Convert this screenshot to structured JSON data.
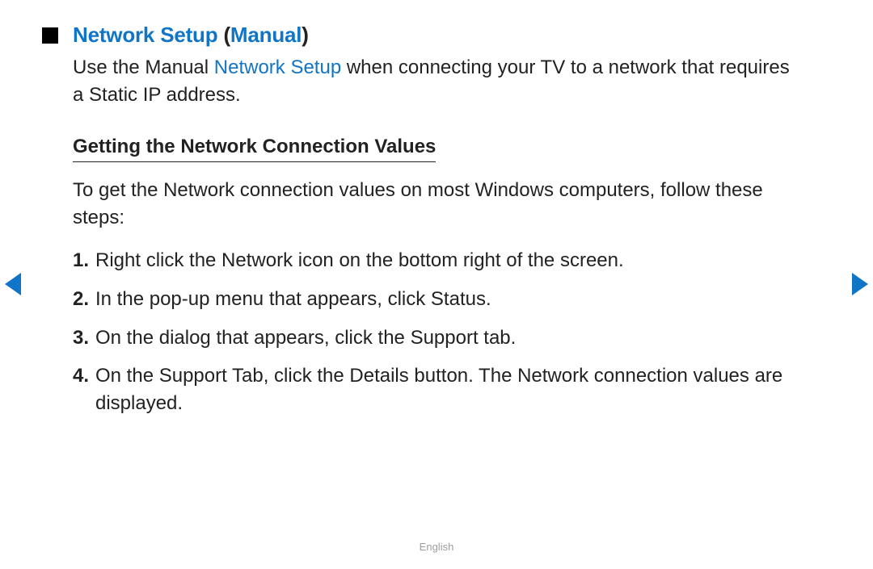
{
  "heading": {
    "part_blue": "Network Setup ",
    "part_black_open": "(",
    "part_blue2": "Manual",
    "part_black_close": ")"
  },
  "intro": {
    "text_before": "Use the Manual ",
    "keyword": "Network Setup",
    "text_after": " when connecting your TV to a network that requires a Static IP address."
  },
  "subheading": "Getting the Network Connection Values",
  "subintro": "To get the Network connection values on most Windows computers, follow these steps:",
  "steps": [
    "Right click the Network icon on the bottom right of the screen.",
    "In the pop-up menu that appears, click Status.",
    "On the dialog that appears, click the Support tab.",
    "On the Support Tab, click the Details button. The Network connection values are displayed."
  ],
  "footer": {
    "language": "English"
  }
}
